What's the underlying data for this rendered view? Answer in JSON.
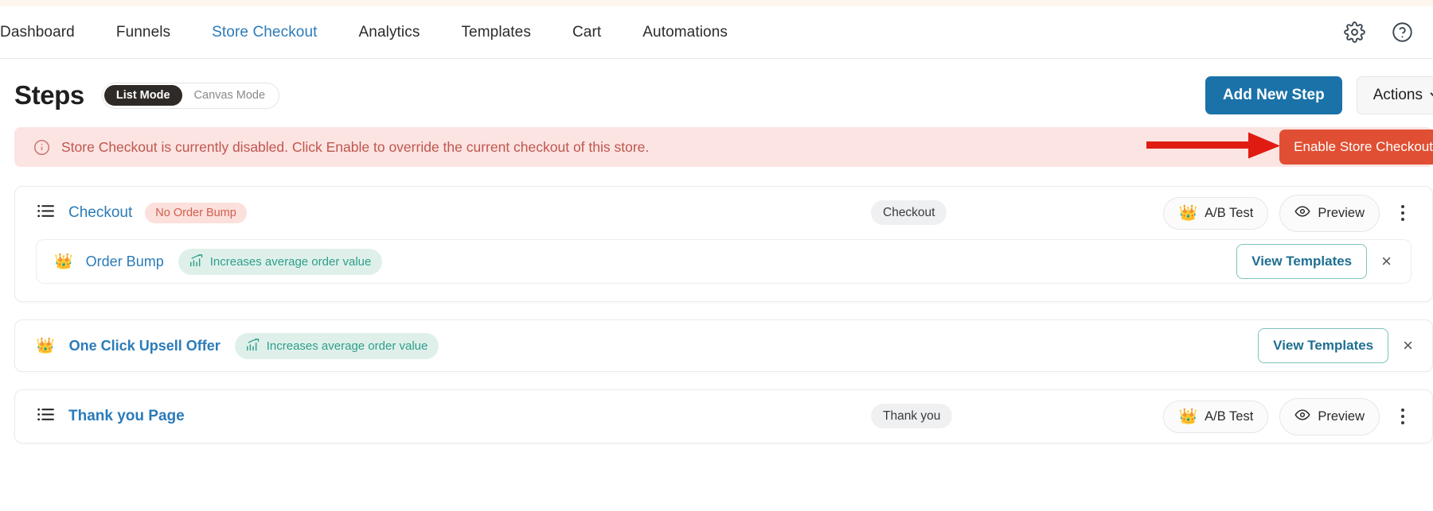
{
  "nav": {
    "items": [
      {
        "label": "Dashboard",
        "active": false
      },
      {
        "label": "Funnels",
        "active": false
      },
      {
        "label": "Store Checkout",
        "active": true
      },
      {
        "label": "Analytics",
        "active": false
      },
      {
        "label": "Templates",
        "active": false
      },
      {
        "label": "Cart",
        "active": false
      },
      {
        "label": "Automations",
        "active": false
      }
    ],
    "settings_icon": "gear-icon",
    "help_icon": "question-circle-icon"
  },
  "header": {
    "title": "Steps",
    "mode_toggle": {
      "list_label": "List Mode",
      "canvas_label": "Canvas Mode",
      "selected": "List Mode"
    },
    "add_step_label": "Add New Step",
    "actions_label": "Actions"
  },
  "alert": {
    "icon": "info-circle-icon",
    "message": "Store Checkout is currently disabled. Click Enable to override the current checkout of this store.",
    "button_label": "Enable Store Checkout",
    "annotation": "red-arrow-pointing-right"
  },
  "steps": [
    {
      "icon": "list-icon",
      "name": "Checkout",
      "badge": "No Order Bump",
      "type_badge": "Checkout",
      "ab_test_label": "A/B Test",
      "preview_label": "Preview",
      "menu": "more-options",
      "sub": {
        "icon": "crown-icon",
        "name": "Order Bump",
        "badge": "Increases average order value",
        "badge_icon": "chart-up-icon",
        "action_label": "View Templates",
        "close": "×"
      }
    },
    {
      "icon": "crown-icon",
      "name": "One Click Upsell Offer",
      "badge": "Increases average order value",
      "badge_icon": "chart-up-icon",
      "action_label": "View Templates",
      "close": "×"
    },
    {
      "icon": "list-icon",
      "name": "Thank you Page",
      "type_badge": "Thank you",
      "ab_test_label": "A/B Test",
      "preview_label": "Preview",
      "menu": "more-options"
    }
  ],
  "colors": {
    "accent_blue": "#2b7bb9",
    "primary_button": "#1b72a8",
    "danger": "#e04f33",
    "alert_bg": "#fbe4e2",
    "alert_text": "#c0564e",
    "teal": "#2f9e8a",
    "annotation_red": "#e01b12",
    "toggle_active": "#2e2a27"
  }
}
